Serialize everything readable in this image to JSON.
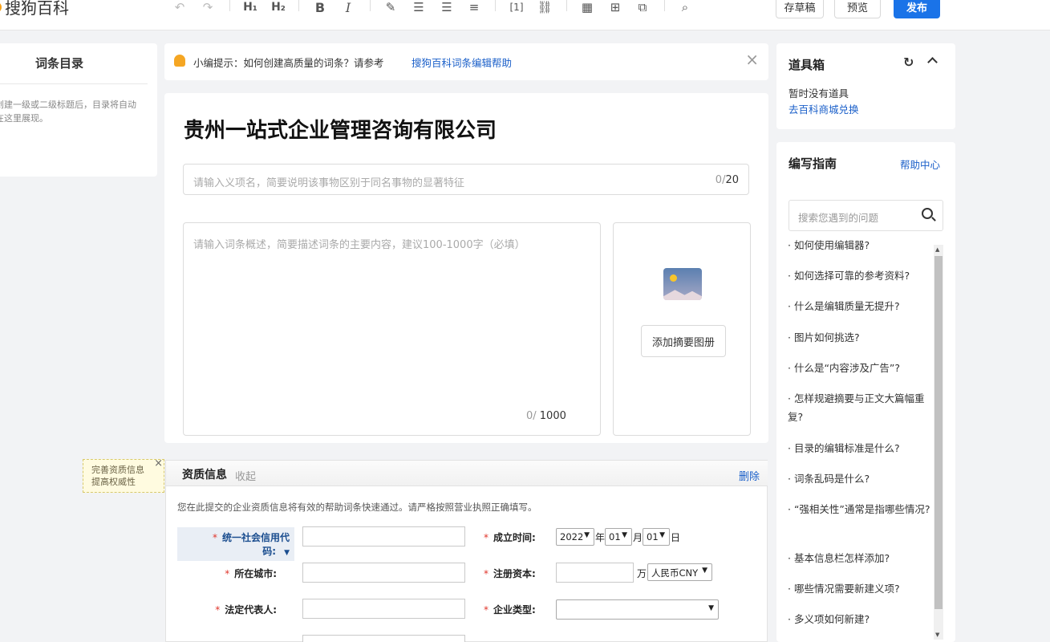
{
  "toolbar": {
    "logo": "搜狗百科",
    "icons": [
      "undo-icon",
      "redo-icon",
      "h1-icon",
      "h2-icon",
      "bold-icon",
      "italic-icon",
      "clear-format-icon",
      "ordered-list-icon",
      "unordered-list-icon",
      "indent-icon",
      "reference-icon",
      "link-icon",
      "table-icon",
      "insert-icon",
      "module-icon",
      "preview-search-icon"
    ],
    "h1": "H₁",
    "h2": "H₂",
    "bold": "B",
    "italic": "I",
    "save_draft": "存草稿",
    "preview": "预览",
    "publish": "发布"
  },
  "toc": {
    "title": "词条目录",
    "hint": "创建一级或二级标题后，目录将自动在这里展现。"
  },
  "tip": {
    "text": "小编提示：如何创建高质量的词条？请参考",
    "link": "搜狗百科词条编辑帮助",
    "close": "×"
  },
  "editor": {
    "title": "贵州一站式企业管理咨询有限公司",
    "subtitle_placeholder": "请输入义项名，简要说明该事物区别于同名事物的显著特征",
    "subtitle_count": "0/",
    "subtitle_max": "20",
    "summary_placeholder": "请输入词条概述，简要描述词条的主要内容，建议100-1000字（必填）",
    "summary_count": "0/",
    "summary_max": " 1000",
    "album_button": "添加摘要图册"
  },
  "note": {
    "line1": "完善资质信息",
    "line2": "提高权威性",
    "close": "×"
  },
  "qualification": {
    "title": "资质信息",
    "collapse": "收起",
    "delete": "删除",
    "description": "您在此提交的企业资质信息将有效的帮助词条快速通过。请严格按照营业执照正确填写。",
    "credit_code_label": "统一社会信用代码:",
    "city_label": "所在城市:",
    "legal_rep_label": "法定代表人:",
    "founded_label": "成立时间:",
    "capital_label": "注册资本:",
    "company_type_label": "企业类型:",
    "year": "2022",
    "year_unit": "年",
    "month": "01",
    "month_unit": "月",
    "day": "01",
    "day_unit": "日",
    "capital_unit": "万",
    "currency": "人民币CNY",
    "required": "*"
  },
  "toolbox": {
    "title": "道具箱",
    "empty": "暂时没有道具",
    "link": "去百科商城兑换"
  },
  "guide": {
    "title": "编写指南",
    "help": "帮助中心",
    "search_placeholder": "搜索您遇到的问题",
    "items": [
      "· 如何使用编辑器?",
      "· 如何选择可靠的参考资料?",
      "· 什么是编辑质量无提升?",
      "· 图片如何挑选?",
      "· 什么是“内容涉及广告”?",
      "· 怎样规避摘要与正文大篇幅重复?",
      "· 目录的编辑标准是什么?",
      "· 词条乱码是什么?",
      "· “强相关性”通常是指哪些情况?",
      "· 基本信息栏怎样添加?",
      "· 哪些情况需要新建义项?",
      "· 多义项如何新建?"
    ]
  }
}
